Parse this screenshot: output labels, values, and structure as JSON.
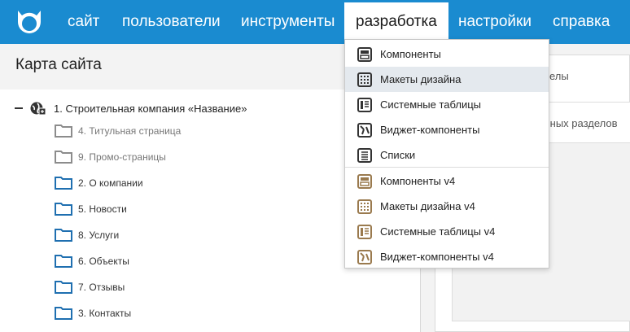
{
  "topnav": {
    "items": [
      "сайт",
      "пользователи",
      "инструменты",
      "разработка",
      "настройки",
      "справка"
    ],
    "active_index": 3
  },
  "sitemap": {
    "title": "Карта сайта",
    "root": "1. Строительная компания «Название»",
    "items": [
      {
        "label": "4. Титульная страница",
        "state": "disabled"
      },
      {
        "label": "9. Промо-страницы",
        "state": "disabled"
      },
      {
        "label": "2. О компании",
        "state": "normal"
      },
      {
        "label": "5. Новости",
        "state": "normal"
      },
      {
        "label": "8. Услуги",
        "state": "normal"
      },
      {
        "label": "6. Объекты",
        "state": "normal"
      },
      {
        "label": "7. Отзывы",
        "state": "normal"
      },
      {
        "label": "3. Контакты",
        "state": "normal"
      }
    ]
  },
  "right_panel": {
    "tab_text": "елы",
    "inner_text": "ранных разделов"
  },
  "dev_menu": {
    "items": [
      {
        "label": "Компоненты",
        "icon": "components-icon"
      },
      {
        "label": "Макеты дизайна",
        "icon": "design-templates-icon",
        "highlighted": true
      },
      {
        "label": "Системные таблицы",
        "icon": "system-tables-icon"
      },
      {
        "label": "Виджет-компоненты",
        "icon": "widget-components-icon"
      },
      {
        "label": "Списки",
        "icon": "lists-icon"
      },
      {
        "label": "Компоненты v4",
        "icon": "components-v4-icon"
      },
      {
        "label": "Макеты дизайна v4",
        "icon": "design-templates-v4-icon"
      },
      {
        "label": "Системные таблицы v4",
        "icon": "system-tables-v4-icon"
      },
      {
        "label": "Виджет-компоненты v4",
        "icon": "widget-components-v4-icon"
      }
    ]
  },
  "colors": {
    "topbar": "#1a8bd0",
    "folder_blue": "#1f6fb0",
    "folder_grey": "#8c8c8c",
    "icon_dark": "#333333",
    "icon_brown": "#9a7a4e",
    "menu_highlight": "#e4e9ee"
  }
}
